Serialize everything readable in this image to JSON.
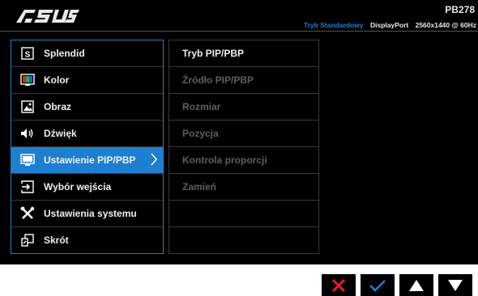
{
  "header": {
    "brand": "ASUS",
    "model": "PB278",
    "mode": "Tryb Standardowy",
    "port": "DisplayPort",
    "resolution": "2560x1440 @ 60Hz"
  },
  "menu": {
    "items": [
      {
        "label": "Splendid",
        "icon": "splendid-icon"
      },
      {
        "label": "Kolor",
        "icon": "color-icon"
      },
      {
        "label": "Obraz",
        "icon": "image-icon"
      },
      {
        "label": "Dźwięk",
        "icon": "speaker-icon"
      },
      {
        "label": "Ustawienie PIP/PBP",
        "icon": "pip-icon",
        "active": true
      },
      {
        "label": "Wybór wejścia",
        "icon": "input-icon"
      },
      {
        "label": "Ustawienia systemu",
        "icon": "tools-icon"
      },
      {
        "label": "Skrót",
        "icon": "shortcut-icon"
      }
    ]
  },
  "submenu": {
    "items": [
      {
        "label": "Tryb PIP/PBP",
        "enabled": true
      },
      {
        "label": "Źródło PIP/PBP",
        "enabled": false
      },
      {
        "label": "Rozmiar",
        "enabled": false
      },
      {
        "label": "Pozycja",
        "enabled": false
      },
      {
        "label": "Kontrola proporcji",
        "enabled": false
      },
      {
        "label": "Zamień",
        "enabled": false
      },
      {
        "label": "",
        "enabled": false
      },
      {
        "label": "",
        "enabled": false
      }
    ]
  },
  "buttons": [
    "close-icon",
    "check-icon",
    "up-arrow-icon",
    "down-arrow-icon"
  ],
  "colors": {
    "accent": "#1e7fd0",
    "close": "#e0202a",
    "disabled": "#5f5f5f",
    "text": "#f0f0f0"
  }
}
